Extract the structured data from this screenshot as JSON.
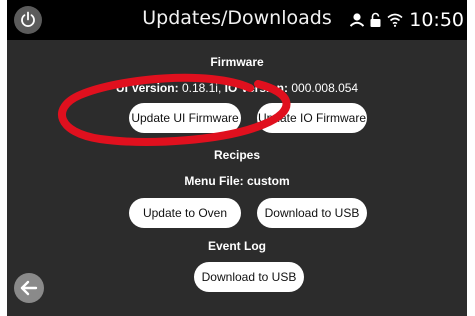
{
  "header": {
    "title": "Updates/Downloads",
    "time": "10:50",
    "icons": [
      "power-icon",
      "user-icon",
      "lock-icon",
      "wifi-icon"
    ]
  },
  "firmware": {
    "section_title": "Firmware",
    "ui_version_label": "UI Version:",
    "ui_version_value": "0.18.1i,",
    "io_version_label": "IO Version:",
    "io_version_value": "000.008.054",
    "update_ui_label": "Update UI Firmware",
    "update_io_label": "Update IO Firmware"
  },
  "recipes": {
    "section_title": "Recipes",
    "menu_file_text": "Menu File: custom",
    "update_oven_label": "Update to Oven",
    "download_usb_label": "Download to USB"
  },
  "event_log": {
    "section_title": "Event Log",
    "download_usb_label": "Download to USB"
  },
  "nav": {
    "back_icon": "arrow-left-icon"
  },
  "colors": {
    "background": "#2c2c2c",
    "header": "#000000",
    "button": "#ffffff",
    "annotation": "#e0101e"
  }
}
